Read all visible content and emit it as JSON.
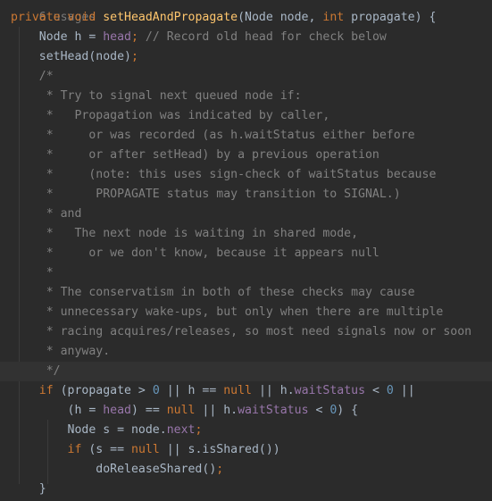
{
  "usages_hint": "6 usages",
  "lines": [
    {
      "indent": "",
      "tokens": [
        {
          "t": "private ",
          "c": "kw"
        },
        {
          "t": "void ",
          "c": "kw"
        },
        {
          "t": "setHeadAndPropagate",
          "c": "fn"
        },
        {
          "t": "(Node node, ",
          "c": "id"
        },
        {
          "t": "int ",
          "c": "kw"
        },
        {
          "t": "propagate) {",
          "c": "id"
        }
      ]
    },
    {
      "indent": "    ",
      "tokens": [
        {
          "t": "Node h = ",
          "c": "id"
        },
        {
          "t": "head",
          "c": "fld"
        },
        {
          "t": "; ",
          "c": "kw"
        },
        {
          "t": "// Record old head for check below",
          "c": "cmt"
        }
      ]
    },
    {
      "indent": "    ",
      "tokens": [
        {
          "t": "setHead(node)",
          "c": "id"
        },
        {
          "t": ";",
          "c": "kw"
        }
      ]
    },
    {
      "indent": "    ",
      "tokens": [
        {
          "t": "/*",
          "c": "cmt"
        }
      ]
    },
    {
      "indent": "    ",
      "tokens": [
        {
          "t": " * Try to signal next queued node if:",
          "c": "cmt"
        }
      ]
    },
    {
      "indent": "    ",
      "tokens": [
        {
          "t": " *   Propagation was indicated by caller,",
          "c": "cmt"
        }
      ]
    },
    {
      "indent": "    ",
      "tokens": [
        {
          "t": " *     or was recorded (as h.waitStatus either before",
          "c": "cmt"
        }
      ]
    },
    {
      "indent": "    ",
      "tokens": [
        {
          "t": " *     or after setHead) by a previous operation",
          "c": "cmt"
        }
      ]
    },
    {
      "indent": "    ",
      "tokens": [
        {
          "t": " *     (note: this uses sign-check of waitStatus because",
          "c": "cmt"
        }
      ]
    },
    {
      "indent": "    ",
      "tokens": [
        {
          "t": " *      PROPAGATE status may transition to SIGNAL.)",
          "c": "cmt"
        }
      ]
    },
    {
      "indent": "    ",
      "tokens": [
        {
          "t": " * and",
          "c": "cmt"
        }
      ]
    },
    {
      "indent": "    ",
      "tokens": [
        {
          "t": " *   The next node is waiting in shared mode,",
          "c": "cmt"
        }
      ]
    },
    {
      "indent": "    ",
      "tokens": [
        {
          "t": " *     or we don't know, because it appears null",
          "c": "cmt"
        }
      ]
    },
    {
      "indent": "    ",
      "tokens": [
        {
          "t": " *",
          "c": "cmt"
        }
      ]
    },
    {
      "indent": "    ",
      "tokens": [
        {
          "t": " * The conservatism in both of these checks may cause",
          "c": "cmt"
        }
      ]
    },
    {
      "indent": "    ",
      "tokens": [
        {
          "t": " * unnecessary wake-ups, but only when there are multiple",
          "c": "cmt"
        }
      ]
    },
    {
      "indent": "    ",
      "tokens": [
        {
          "t": " * racing acquires/releases, so most need signals now or soon",
          "c": "cmt"
        }
      ]
    },
    {
      "indent": "    ",
      "tokens": [
        {
          "t": " * anyway.",
          "c": "cmt"
        }
      ]
    },
    {
      "indent": "    ",
      "highlight": true,
      "tokens": [
        {
          "t": " */",
          "c": "cmt"
        }
      ]
    },
    {
      "indent": "    ",
      "tokens": [
        {
          "t": "if ",
          "c": "kw"
        },
        {
          "t": "(propagate > ",
          "c": "id"
        },
        {
          "t": "0 ",
          "c": "num"
        },
        {
          "t": "|| h == ",
          "c": "id"
        },
        {
          "t": "null ",
          "c": "kw"
        },
        {
          "t": "|| h.",
          "c": "id"
        },
        {
          "t": "waitStatus",
          "c": "fld"
        },
        {
          "t": " < ",
          "c": "id"
        },
        {
          "t": "0 ",
          "c": "num"
        },
        {
          "t": "||",
          "c": "id"
        }
      ]
    },
    {
      "indent": "        ",
      "tokens": [
        {
          "t": "(h = ",
          "c": "id"
        },
        {
          "t": "head",
          "c": "fld"
        },
        {
          "t": ") == ",
          "c": "id"
        },
        {
          "t": "null ",
          "c": "kw"
        },
        {
          "t": "|| h.",
          "c": "id"
        },
        {
          "t": "waitStatus",
          "c": "fld"
        },
        {
          "t": " < ",
          "c": "id"
        },
        {
          "t": "0",
          "c": "num"
        },
        {
          "t": ") {",
          "c": "id"
        }
      ]
    },
    {
      "indent": "        ",
      "tokens": [
        {
          "t": "Node s = node.",
          "c": "id"
        },
        {
          "t": "next",
          "c": "fld"
        },
        {
          "t": ";",
          "c": "kw"
        }
      ]
    },
    {
      "indent": "        ",
      "tokens": [
        {
          "t": "if ",
          "c": "kw"
        },
        {
          "t": "(s == ",
          "c": "id"
        },
        {
          "t": "null ",
          "c": "kw"
        },
        {
          "t": "|| s.isShared())",
          "c": "id"
        }
      ]
    },
    {
      "indent": "            ",
      "tokens": [
        {
          "t": "doReleaseShared()",
          "c": "id"
        },
        {
          "t": ";",
          "c": "kw"
        }
      ]
    },
    {
      "indent": "    ",
      "tokens": [
        {
          "t": "}",
          "c": "id"
        }
      ]
    }
  ]
}
